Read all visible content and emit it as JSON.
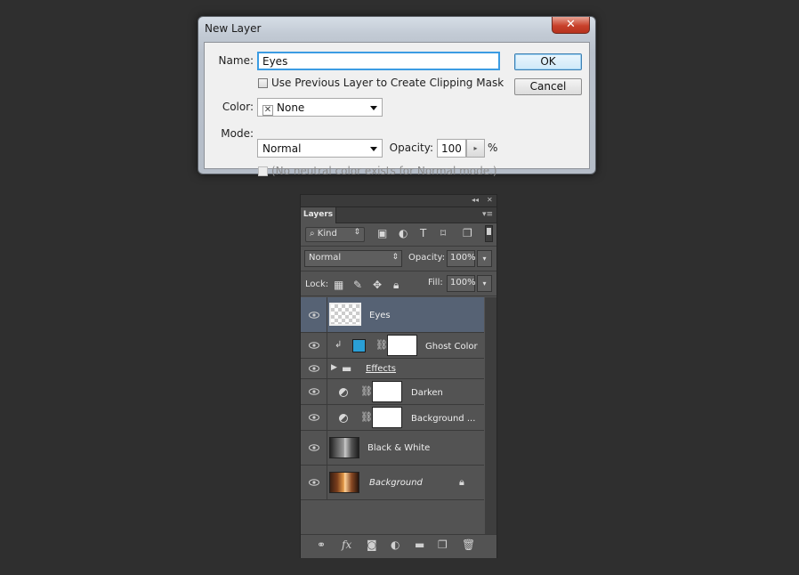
{
  "dialog": {
    "title": "New Layer",
    "close_glyph": "✕",
    "name_label": "Name:",
    "name_value": "Eyes",
    "clipping_label": "Use Previous Layer to Create Clipping Mask",
    "color_label": "Color:",
    "color_value": "None",
    "mode_label": "Mode:",
    "mode_value": "Normal",
    "opacity_label": "Opacity:",
    "opacity_value": "100",
    "percent": "%",
    "neutral_label": "(No neutral color exists for Normal mode.)",
    "ok": "OK",
    "cancel": "Cancel"
  },
  "panel": {
    "collapse_glyph": "◂◂",
    "close_glyph": "✕",
    "tab": "Layers",
    "menu_glyph": "▾≡",
    "kind": "Kind",
    "blend_mode": "Normal",
    "opacity_label": "Opacity:",
    "opacity_value": "100%",
    "lock_label": "Lock:",
    "fill_label": "Fill:",
    "fill_value": "100%",
    "layers": [
      {
        "name": "Eyes"
      },
      {
        "name": "Ghost Color"
      },
      {
        "name": "Effects"
      },
      {
        "name": "Darken"
      },
      {
        "name": "Background ..."
      },
      {
        "name": "Black & White"
      },
      {
        "name": "Background"
      }
    ]
  },
  "colors": {
    "accent_blue": "#3c9ce3",
    "selected_layer": "#566274",
    "swatch": "#2a9fd6"
  }
}
